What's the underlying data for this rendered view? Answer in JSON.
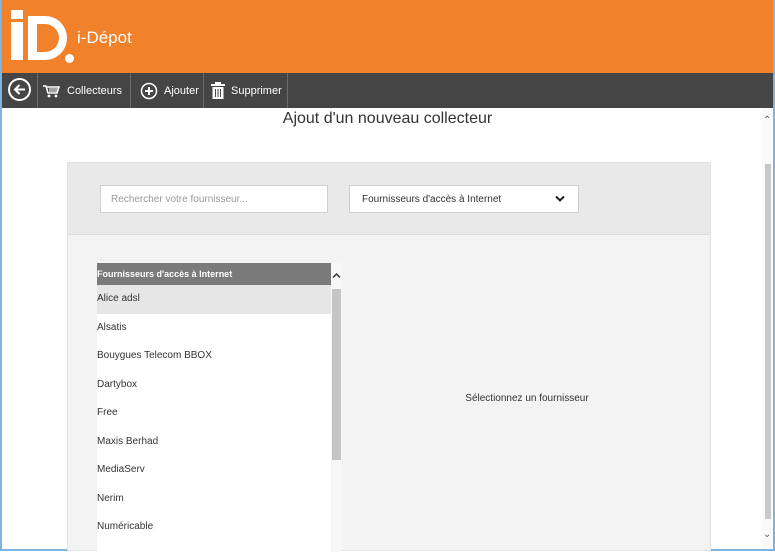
{
  "app": {
    "title": "i-Dépot"
  },
  "toolbar": {
    "collecteurs_label": "Collecteurs",
    "ajouter_label": "Ajouter",
    "supprimer_label": "Supprimer"
  },
  "page": {
    "title": "Ajout d'un nouveau collecteur"
  },
  "search": {
    "placeholder": "Rechercher votre fournisseur..."
  },
  "category_select": {
    "selected": "Fournisseurs d'accès à Internet"
  },
  "provider_list": {
    "header": "Fournisseurs d'accès à Internet",
    "items": [
      {
        "label": "Alice adsl",
        "selected": true
      },
      {
        "label": "Alsatis"
      },
      {
        "label": "Bouygues Telecom BBOX"
      },
      {
        "label": "Dartybox"
      },
      {
        "label": "Free"
      },
      {
        "label": "Maxis Berhad"
      },
      {
        "label": "MediaServ"
      },
      {
        "label": "Nerim"
      },
      {
        "label": "Numéricable"
      }
    ]
  },
  "detail": {
    "empty_message": "Sélectionnez un fournisseur"
  },
  "colors": {
    "header": "#f2812b",
    "toolbar": "#454545",
    "list_header": "#7a7a7a"
  },
  "icons": [
    "back-arrow-icon",
    "cart-icon",
    "plus-circle-icon",
    "trash-icon",
    "chevron-down-icon",
    "chevron-up-icon"
  ]
}
